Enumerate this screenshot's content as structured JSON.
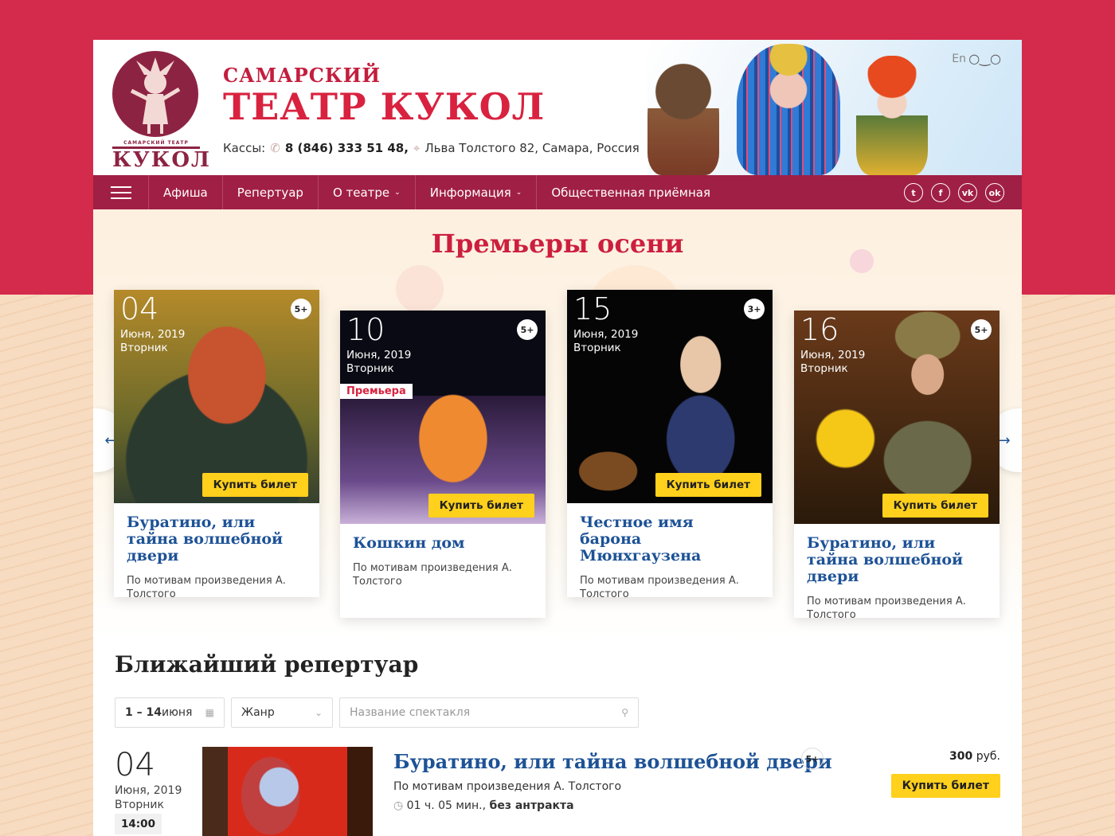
{
  "header": {
    "brand_small": "САМАРСКИЙ",
    "brand_big": "ТЕАТР КУКОЛ",
    "logo_word": "КУКОЛ",
    "logo_small": "САМАРСКИЙ ТЕАТР",
    "cashbox_label": "Кассы:",
    "phone": "8 (846) 333 51 48,",
    "address": "Льва Толстого 82, Самара, Россия",
    "lang": "En",
    "glasses_icon": "glasses-icon"
  },
  "nav": {
    "items": [
      {
        "label": "Афиша"
      },
      {
        "label": "Репертуар"
      },
      {
        "label": "О театре",
        "caret": "⌄"
      },
      {
        "label": "Информация",
        "caret": "⌄"
      },
      {
        "label": "Общественная приёмная"
      }
    ],
    "social": [
      "twitter-icon",
      "facebook-icon",
      "vk-icon",
      "odnoklassniki-icon"
    ]
  },
  "premieres": {
    "title": "Премьеры осени",
    "cards": [
      {
        "day": "04",
        "month_year": "Июня, 2019",
        "weekday": "Вторник",
        "age": "5+",
        "buy": "Купить билет",
        "name": "Буратино, или тайна волшебной двери",
        "desc": "По мотивам произведения А. Толстого"
      },
      {
        "day": "10",
        "month_year": "Июня, 2019",
        "weekday": "Вторник",
        "age": "5+",
        "tag": "Премьера",
        "buy": "Купить билет",
        "name": "Кошкин дом",
        "desc": "По мотивам произведения А. Толстого"
      },
      {
        "day": "15",
        "month_year": "Июня, 2019",
        "weekday": "Вторник",
        "age": "3+",
        "buy": "Купить билет",
        "name": "Честное имя барона Мюнхгаузена",
        "desc": "По мотивам произведения А. Толстого"
      },
      {
        "day": "16",
        "month_year": "Июня, 2019",
        "weekday": "Вторник",
        "age": "5+",
        "buy": "Купить билет",
        "name": "Буратино, или тайна волшебной двери",
        "desc": "По мотивам произведения А. Толстого"
      }
    ],
    "prev_icon": "←",
    "next_icon": "→"
  },
  "repertoire": {
    "title": "Ближайший репертуар",
    "filters": {
      "date_bold": "1 – 14",
      "date_rest": " июня",
      "genre": "Жанр",
      "search_placeholder": "Название спектакля"
    },
    "rows": [
      {
        "day": "04",
        "month_year": "Июня, 2019",
        "weekday": "Вторник",
        "time": "14:00",
        "name": "Буратино, или тайна волшебной двери",
        "age": "5+",
        "desc": "По мотивам произведения А. Толстого",
        "duration": "01 ч. 05 мин.,",
        "intermission": "без антракта",
        "price": "300",
        "currency": "руб.",
        "buy": "Купить билет"
      }
    ]
  },
  "colors": {
    "brand_red": "#d8223f",
    "nav_bg": "#a01f45",
    "link_blue": "#1d5296",
    "button_yellow": "#ffd01c"
  }
}
